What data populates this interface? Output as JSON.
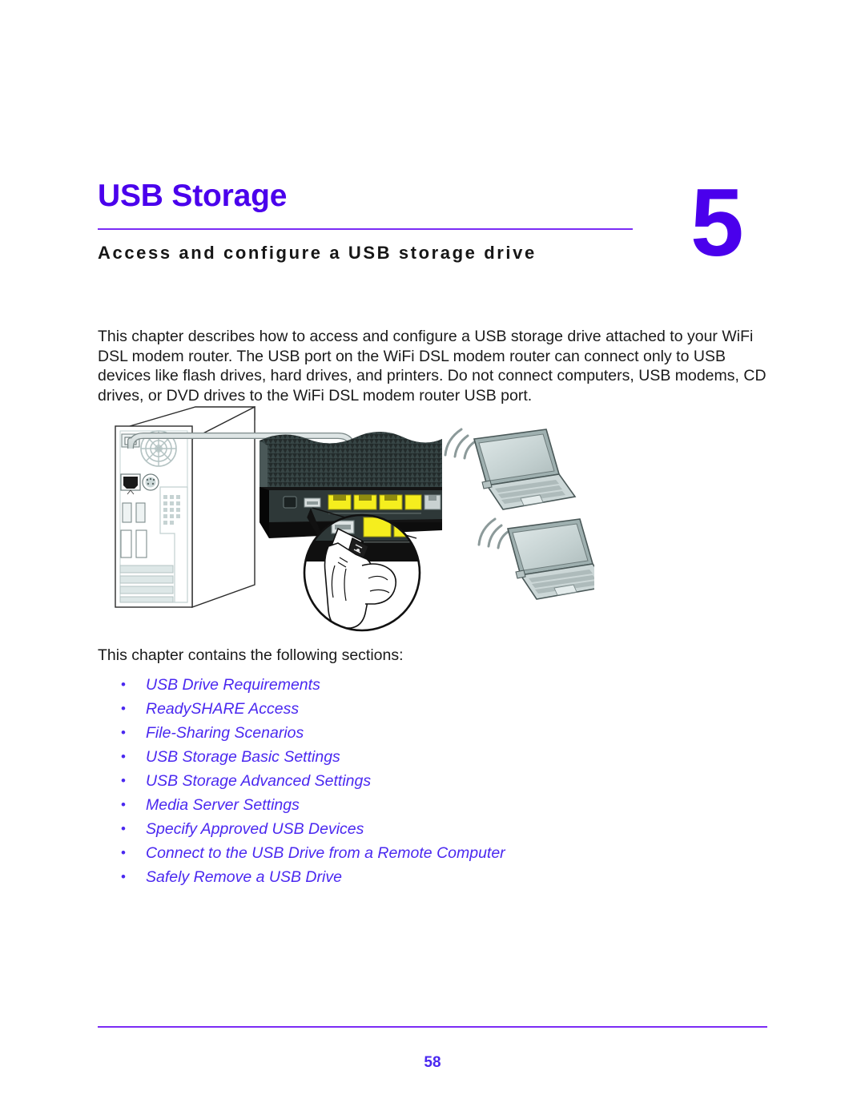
{
  "chapter": {
    "title": "USB Storage",
    "number": "5",
    "subtitle": "Access and configure a USB storage drive",
    "accent_color": "#4a00ec",
    "rule_color": "#7b2cf5",
    "link_color": "#4a28f0"
  },
  "intro": {
    "paragraph": "This chapter describes how to access and configure a USB storage drive attached to your WiFi DSL modem router. The USB port on the WiFi DSL modem router can connect only to USB devices like flash drives, hard drives, and printers. Do not connect computers, USB modems, CD drives, or DVD drives to the WiFi DSL modem router USB port."
  },
  "sections": {
    "lead_in": "This chapter contains the following sections:",
    "bullet": "•",
    "items": [
      {
        "label": "USB Drive Requirements"
      },
      {
        "label": "ReadySHARE Access"
      },
      {
        "label": "File-Sharing Scenarios"
      },
      {
        "label": "USB Storage Basic Settings"
      },
      {
        "label": "USB Storage Advanced Settings"
      },
      {
        "label": "Media Server Settings"
      },
      {
        "label": "Specify Approved USB Devices"
      },
      {
        "label": "Connect to the USB Drive from a Remote Computer"
      },
      {
        "label": "Safely Remove a USB Drive"
      }
    ]
  },
  "illustration": {
    "caption": "",
    "parts": {
      "computer": "desktop-pc-rear-panel",
      "router": "wifi-dsl-modem-router-rear-ports",
      "magnifier": "usb-drive-insertion-closeup",
      "laptop_top": "wireless-laptop",
      "laptop_bottom": "wireless-laptop",
      "cable": "ethernet-cable"
    },
    "colors": {
      "router_body": "#1c1c1c",
      "lan_port_yellow": "#f5ee1e",
      "device_gray": "#c9d6d6",
      "cable_gray": "#b9c6c6"
    }
  },
  "footer": {
    "page_number": "58"
  }
}
